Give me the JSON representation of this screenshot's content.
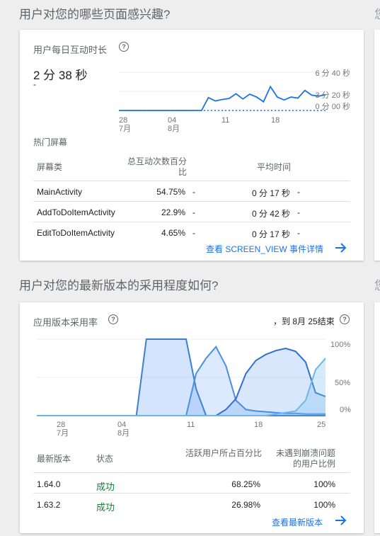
{
  "section1": {
    "title": "用户对您的哪些页面感兴趣?"
  },
  "section2": {
    "title": "用户对您的最新版本的采用程度如何?"
  },
  "side": {
    "glyph": "您"
  },
  "engagement": {
    "title": "用户每日互动时长",
    "value": "2 分 38 秒",
    "sub": "-",
    "chart_data": {
      "type": "line",
      "x_ticks": [
        {
          "day": "28",
          "month": "7月"
        },
        {
          "day": "04",
          "month": "8月"
        },
        {
          "day": "11",
          "month": ""
        },
        {
          "day": "18",
          "month": ""
        }
      ],
      "y_ticks": [
        "6 分 40 秒",
        "3 分 20 秒",
        "0 分 00 秒"
      ],
      "ylim_seconds": [
        0,
        400
      ],
      "series": [
        {
          "values": [
            0,
            0,
            0,
            0,
            0,
            0,
            0,
            0,
            0,
            0,
            0,
            0,
            0,
            135,
            100,
            115,
            125,
            175,
            120,
            170,
            140,
            90,
            250,
            140,
            110,
            140,
            130,
            210,
            160,
            150,
            165
          ]
        },
        {
          "values": [
            0,
            0,
            0,
            0,
            0,
            0,
            0,
            0,
            0,
            0,
            0,
            0,
            0,
            0,
            0,
            0,
            0,
            0,
            0,
            0,
            0,
            0,
            0,
            0,
            0,
            0,
            0,
            0,
            0,
            0,
            0
          ],
          "dashed": true
        }
      ]
    }
  },
  "screens": {
    "title": "热门屏幕",
    "headers": [
      "屏幕类",
      "总互动次数百分比",
      "平均时间"
    ],
    "rows": [
      {
        "name": "MainActivity",
        "pct": "54.75%",
        "pct_delta": "-",
        "time": "0 分 17 秒",
        "time_delta": "-"
      },
      {
        "name": "AddToDoItemActivity",
        "pct": "22.9%",
        "pct_delta": "-",
        "time": "0 分 42 秒",
        "time_delta": "-"
      },
      {
        "name": "EditToDoItemActivity",
        "pct": "4.65%",
        "pct_delta": "-",
        "time": "0 分 17 秒",
        "time_delta": "-"
      }
    ],
    "link": "查看 SCREEN_VIEW 事件详情"
  },
  "adoption": {
    "title": "应用版本采用率",
    "date_note": "，到 8月 25结束",
    "chart_data": {
      "type": "area",
      "x_ticks": [
        {
          "day": "28",
          "month": "7月"
        },
        {
          "day": "04",
          "month": "8月"
        },
        {
          "day": "11",
          "month": ""
        },
        {
          "day": "18",
          "month": ""
        },
        {
          "day": "25",
          "month": ""
        }
      ],
      "y_ticks": [
        "100%",
        "50%",
        "0%"
      ],
      "ylim": [
        0,
        100
      ],
      "series": [
        {
          "color": "#3b7fd4",
          "fill": "rgba(66,133,244,0.22)",
          "values": [
            0,
            0,
            0,
            0,
            0,
            0,
            0,
            0,
            0,
            0,
            0,
            100,
            100,
            100,
            100,
            100,
            35,
            0,
            0,
            0,
            0,
            0,
            0,
            0,
            0,
            0,
            0,
            0,
            0,
            0
          ]
        },
        {
          "color": "#4a90e2",
          "fill": "rgba(66,133,244,0.18)",
          "values": [
            0,
            0,
            0,
            0,
            0,
            0,
            0,
            0,
            0,
            0,
            0,
            0,
            0,
            0,
            0,
            0,
            55,
            75,
            90,
            65,
            20,
            8,
            6,
            5,
            4,
            3,
            3,
            2,
            2,
            2
          ]
        },
        {
          "color": "#2f6fd0",
          "fill": "rgba(66,133,244,0.20)",
          "values": [
            0,
            0,
            0,
            0,
            0,
            0,
            0,
            0,
            0,
            0,
            0,
            0,
            0,
            0,
            0,
            0,
            0,
            0,
            0,
            8,
            22,
            55,
            72,
            80,
            85,
            88,
            84,
            70,
            30,
            25
          ]
        },
        {
          "color": "#6ab7e8",
          "fill": "rgba(120,190,240,0.30)",
          "values": [
            0,
            0,
            0,
            0,
            0,
            0,
            0,
            0,
            0,
            0,
            0,
            0,
            0,
            0,
            0,
            0,
            0,
            0,
            0,
            0,
            0,
            0,
            0,
            0,
            2,
            4,
            6,
            20,
            60,
            75
          ]
        }
      ]
    },
    "headers": [
      "最新版本",
      "状态",
      "活跃用户所占百分比",
      "未遇到崩溃问题的用户比例"
    ],
    "rows": [
      {
        "version": "1.64.0",
        "status": "成功",
        "active": "68.25%",
        "crash_free": "100%"
      },
      {
        "version": "1.63.2",
        "status": "成功",
        "active": "26.98%",
        "crash_free": "100%"
      }
    ],
    "link": "查看最新版本"
  }
}
